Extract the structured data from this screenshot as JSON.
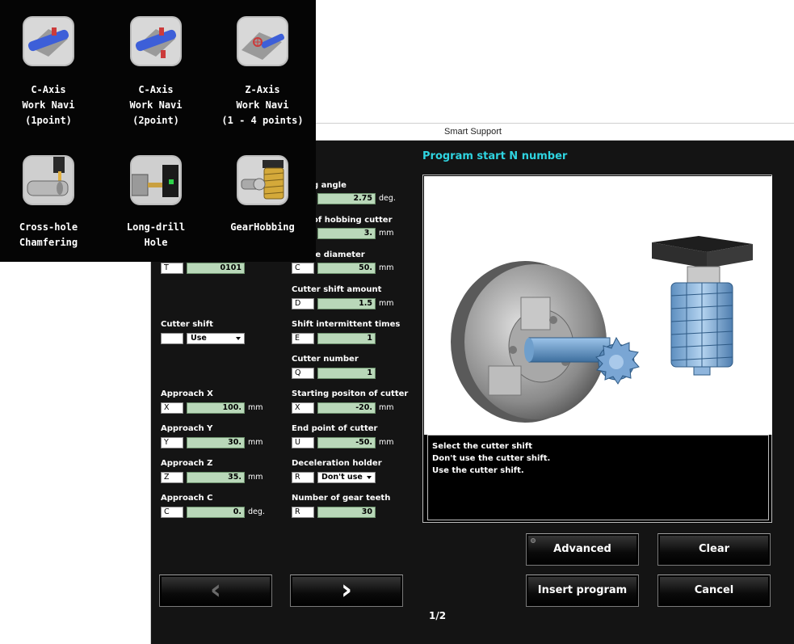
{
  "window": {
    "title": "Smart Support"
  },
  "header": {
    "section_title": "Program start N number"
  },
  "left_fields": {
    "tool": {
      "address": "T",
      "value": "0101"
    },
    "cutter_shift": {
      "label": "Cutter shift",
      "value": "Use"
    },
    "approach_x": {
      "label": "Approach X",
      "address": "X",
      "value": "100.",
      "unit": "mm"
    },
    "approach_y": {
      "label": "Approach Y",
      "address": "Y",
      "value": "30.",
      "unit": "mm"
    },
    "approach_z": {
      "label": "Approach Z",
      "address": "Z",
      "value": "35.",
      "unit": "mm"
    },
    "approach_c": {
      "label": "Approach C",
      "address": "C",
      "value": "0.",
      "unit": "deg."
    }
  },
  "right_fields": {
    "hobbing_angle": {
      "label": "g angle",
      "value": "2.75",
      "unit": "deg."
    },
    "hobbing_cutter": {
      "label": "of hobbing cutter",
      "value": "3.",
      "unit": "mm"
    },
    "diameter": {
      "label": "le diameter",
      "address": "C",
      "value": "50.",
      "unit": "mm"
    },
    "cutter_shift_amount": {
      "label": "Cutter shift amount",
      "address": "D",
      "value": "1.5",
      "unit": "mm"
    },
    "shift_intermittent_times": {
      "label": "Shift intermittent times",
      "address": "E",
      "value": "1"
    },
    "cutter_number": {
      "label": "Cutter number",
      "address": "Q",
      "value": "1"
    },
    "starting_position": {
      "label": "Starting positon of cutter",
      "address": "X",
      "value": "-20.",
      "unit": "mm"
    },
    "end_point": {
      "label": "End point of cutter",
      "address": "U",
      "value": "-50.",
      "unit": "mm"
    },
    "deceleration_holder": {
      "label": "Deceleration holder",
      "address": "R",
      "value": "Don't use"
    },
    "gear_teeth": {
      "label": "Number of gear teeth",
      "address": "R",
      "value": "30"
    }
  },
  "message": {
    "lines": [
      "Select the cutter shift",
      "Don't use the cutter shift.",
      "Use the cutter shift."
    ]
  },
  "buttons": {
    "advanced": "Advanced",
    "clear": "Clear",
    "insert_program": "Insert program",
    "cancel": "Cancel",
    "prev": "‹",
    "next": "›"
  },
  "pager": {
    "text": "1/2"
  },
  "work_navi": [
    {
      "icon": "c-axis-1point-icon",
      "caption": "C-Axis\nWork Navi\n(1point)"
    },
    {
      "icon": "c-axis-2point-icon",
      "caption": "C-Axis\nWork Navi\n(2point)"
    },
    {
      "icon": "z-axis-icon",
      "caption": "Z-Axis\nWork Navi\n(1 - 4 points)"
    },
    {
      "icon": "cross-hole-chamfering-icon",
      "caption": "Cross-hole\nChamfering"
    },
    {
      "icon": "long-drill-hole-icon",
      "caption": "Long-drill\nHole"
    },
    {
      "icon": "gear-hobbing-icon",
      "caption": "GearHobbing"
    }
  ],
  "colors": {
    "accent": "#2fd4e0",
    "field": "#b9d8b9",
    "background": "#141414"
  }
}
